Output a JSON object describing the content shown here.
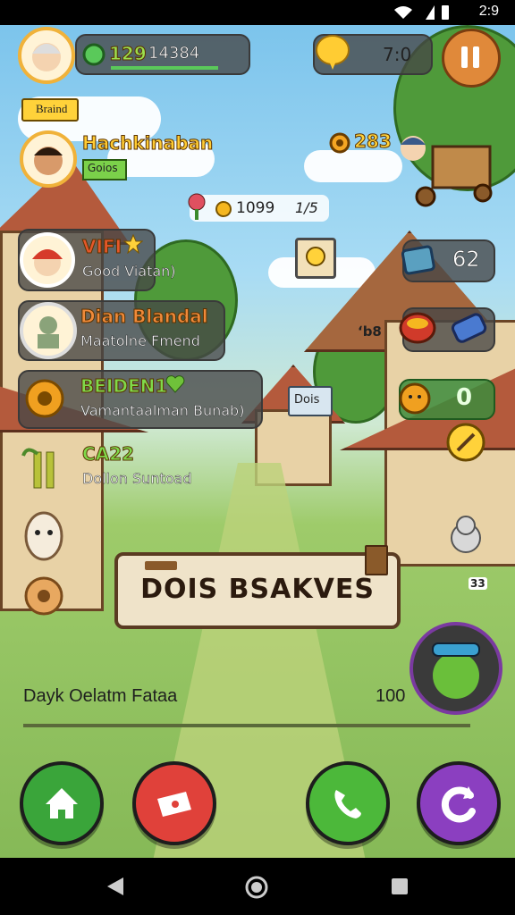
{
  "status_bar": {
    "time": "2:9"
  },
  "top_bar": {
    "coins": "129",
    "coin_label": "14384",
    "energy": "7:0"
  },
  "badge_top": "Braind",
  "players": [
    {
      "name": "Hachkinaban",
      "sub": "Goios"
    },
    {
      "name": "VIFI",
      "sub": "Good Viatan)"
    },
    {
      "name": "Dian Blandal",
      "sub": "Maatolne Fmend"
    },
    {
      "name": "BEIDEN1",
      "sub": "Vamantaalman Bunab)"
    },
    {
      "name": "CA22",
      "sub": "Dollon Suntoad"
    }
  ],
  "center_counter": {
    "amount": "1099",
    "fraction": "1/5"
  },
  "right_stats": {
    "gear_count": "283",
    "item_count": "62",
    "small_tag": "ʻb8",
    "tag_box": "Dois",
    "green_count": "0",
    "tiny_label": "33"
  },
  "plank_title": "DOIS BSAKVES",
  "daily": {
    "label": "Dayk Oelatm Fataa",
    "value": "100"
  },
  "colors": {
    "home": "#3aa53a",
    "red": "#e0413a",
    "phone": "#4cb83a",
    "purple": "#8b3fc0",
    "accent": "#ffd23a"
  },
  "bottom_buttons": [
    {
      "icon": "home-icon"
    },
    {
      "icon": "ticket-icon"
    },
    {
      "icon": "phone-icon"
    },
    {
      "icon": "refresh-icon"
    }
  ]
}
